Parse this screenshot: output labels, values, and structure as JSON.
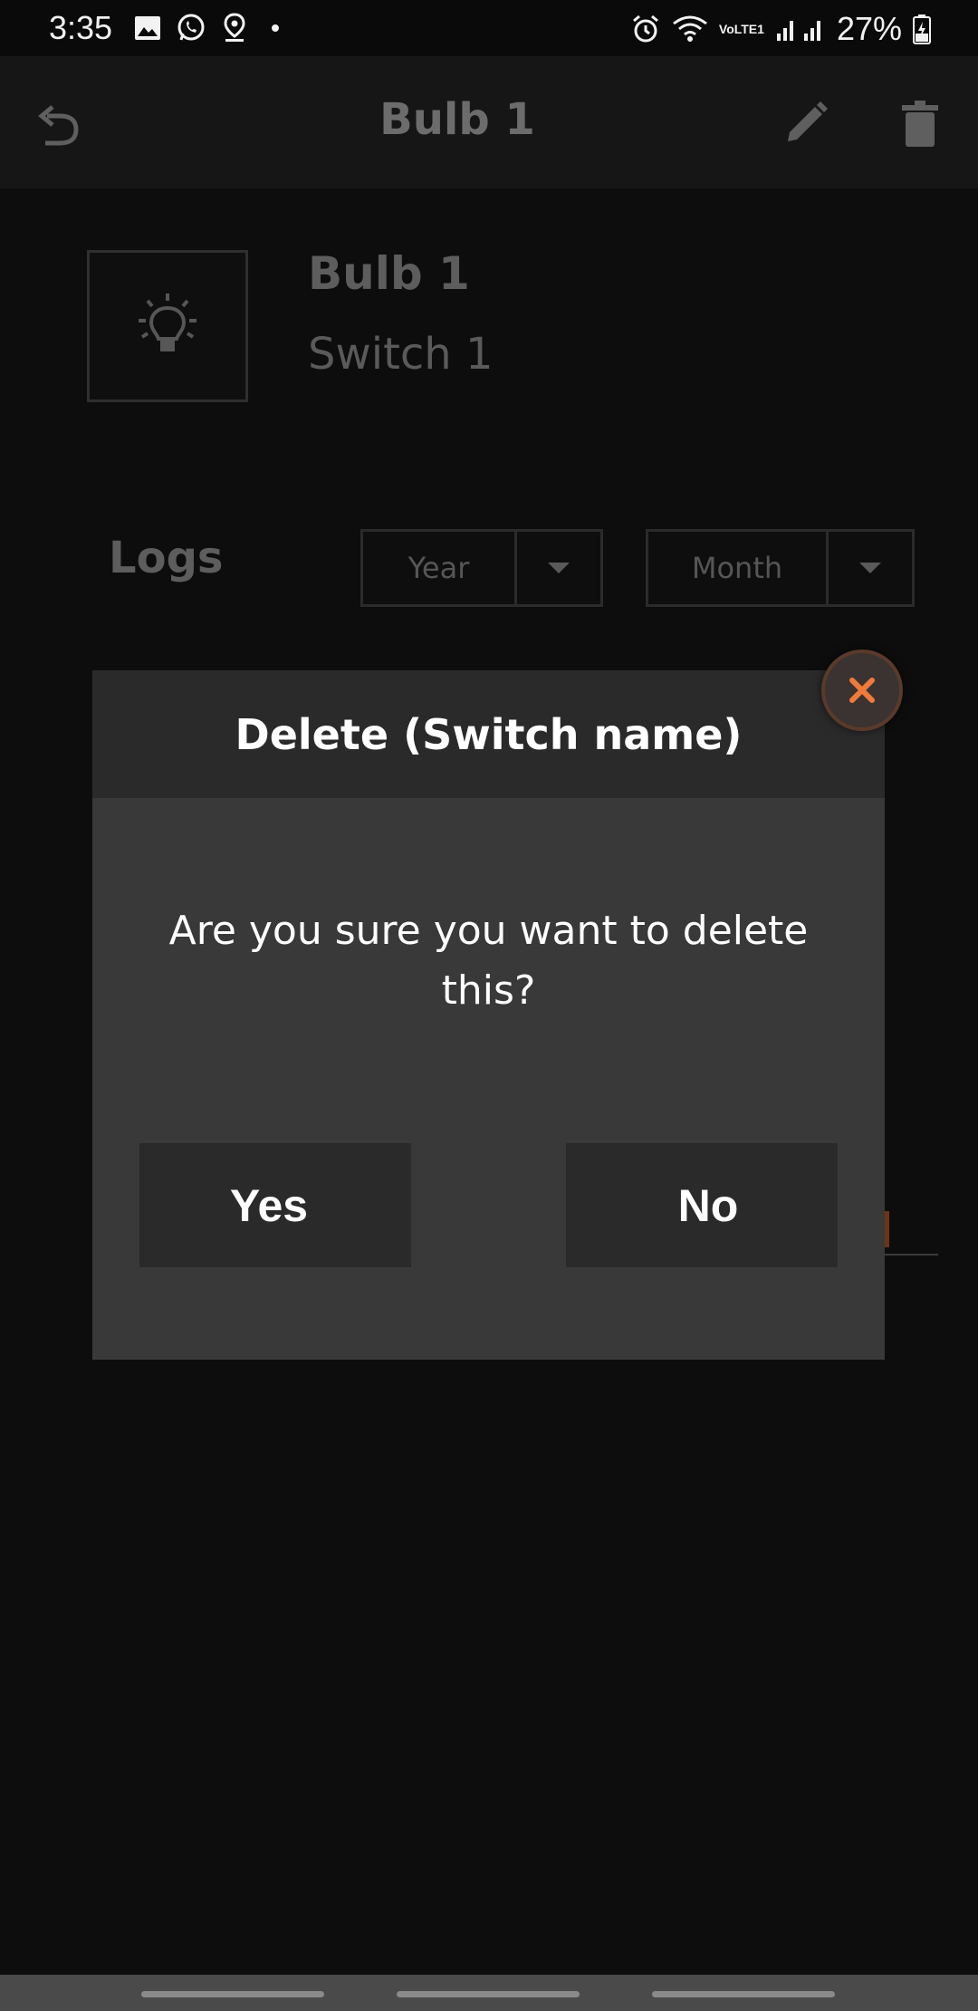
{
  "status_bar": {
    "time": "3:35",
    "lte": "VoLTE1",
    "battery": "27%",
    "left_icons": [
      "gallery-icon",
      "whatsapp-icon",
      "location-icon"
    ],
    "right_icons": [
      "alarm-icon",
      "wifi-icon",
      "signal-icon",
      "battery-icon"
    ]
  },
  "header": {
    "title": "Bulb 1",
    "back_icon": "undo-arrow-icon",
    "edit_icon": "pencil-icon",
    "delete_icon": "trash-icon"
  },
  "device": {
    "icon": "lightbulb-icon",
    "name": "Bulb 1",
    "switch": "Switch 1"
  },
  "logs": {
    "label": "Logs",
    "year_select": "Year",
    "month_select": "Month"
  },
  "dialog": {
    "title": "Delete (Switch name)",
    "message": "Are you sure you want to delete this?",
    "yes_label": "Yes",
    "no_label": "No",
    "close_icon": "close-x-icon",
    "accent": "#f07a3a"
  },
  "colors": {
    "background": "#0d0d0d",
    "dialog_body": "#3a393a",
    "dialog_header": "#2b2a2b"
  }
}
